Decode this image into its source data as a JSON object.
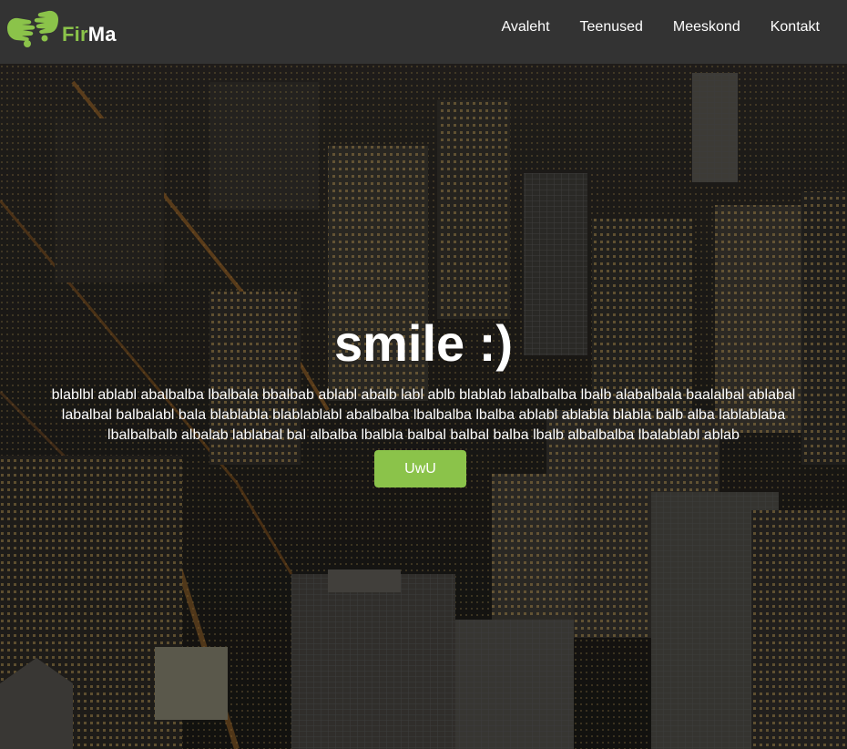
{
  "brand": {
    "name_part1": "Fir",
    "name_part2": "Ma",
    "logo_icon": "hands-logo-icon",
    "accent_color": "#8bc34a"
  },
  "nav": {
    "items": [
      {
        "label": "Avaleht"
      },
      {
        "label": "Teenused"
      },
      {
        "label": "Meeskond"
      },
      {
        "label": "Kontakt"
      }
    ]
  },
  "hero": {
    "background": "night city skyline photo",
    "title": "smile :)",
    "text": "blablbl ablabl abalbalba lbalbala bbalbab ablabl abalb labl ablb blablab labalbalba lbalb alabalbala baalalbal ablabal labalbal balbalabl bala blablabla blablablabl abalbalba lbalbalba lbalba ablabl ablabla blabla balb alba lablablaba lbalbalbalb albalab lablabal bal albalba lbalbla balbal balbal balba lbalb albalbalba lbalablabl ablab",
    "button_label": "UwU"
  }
}
